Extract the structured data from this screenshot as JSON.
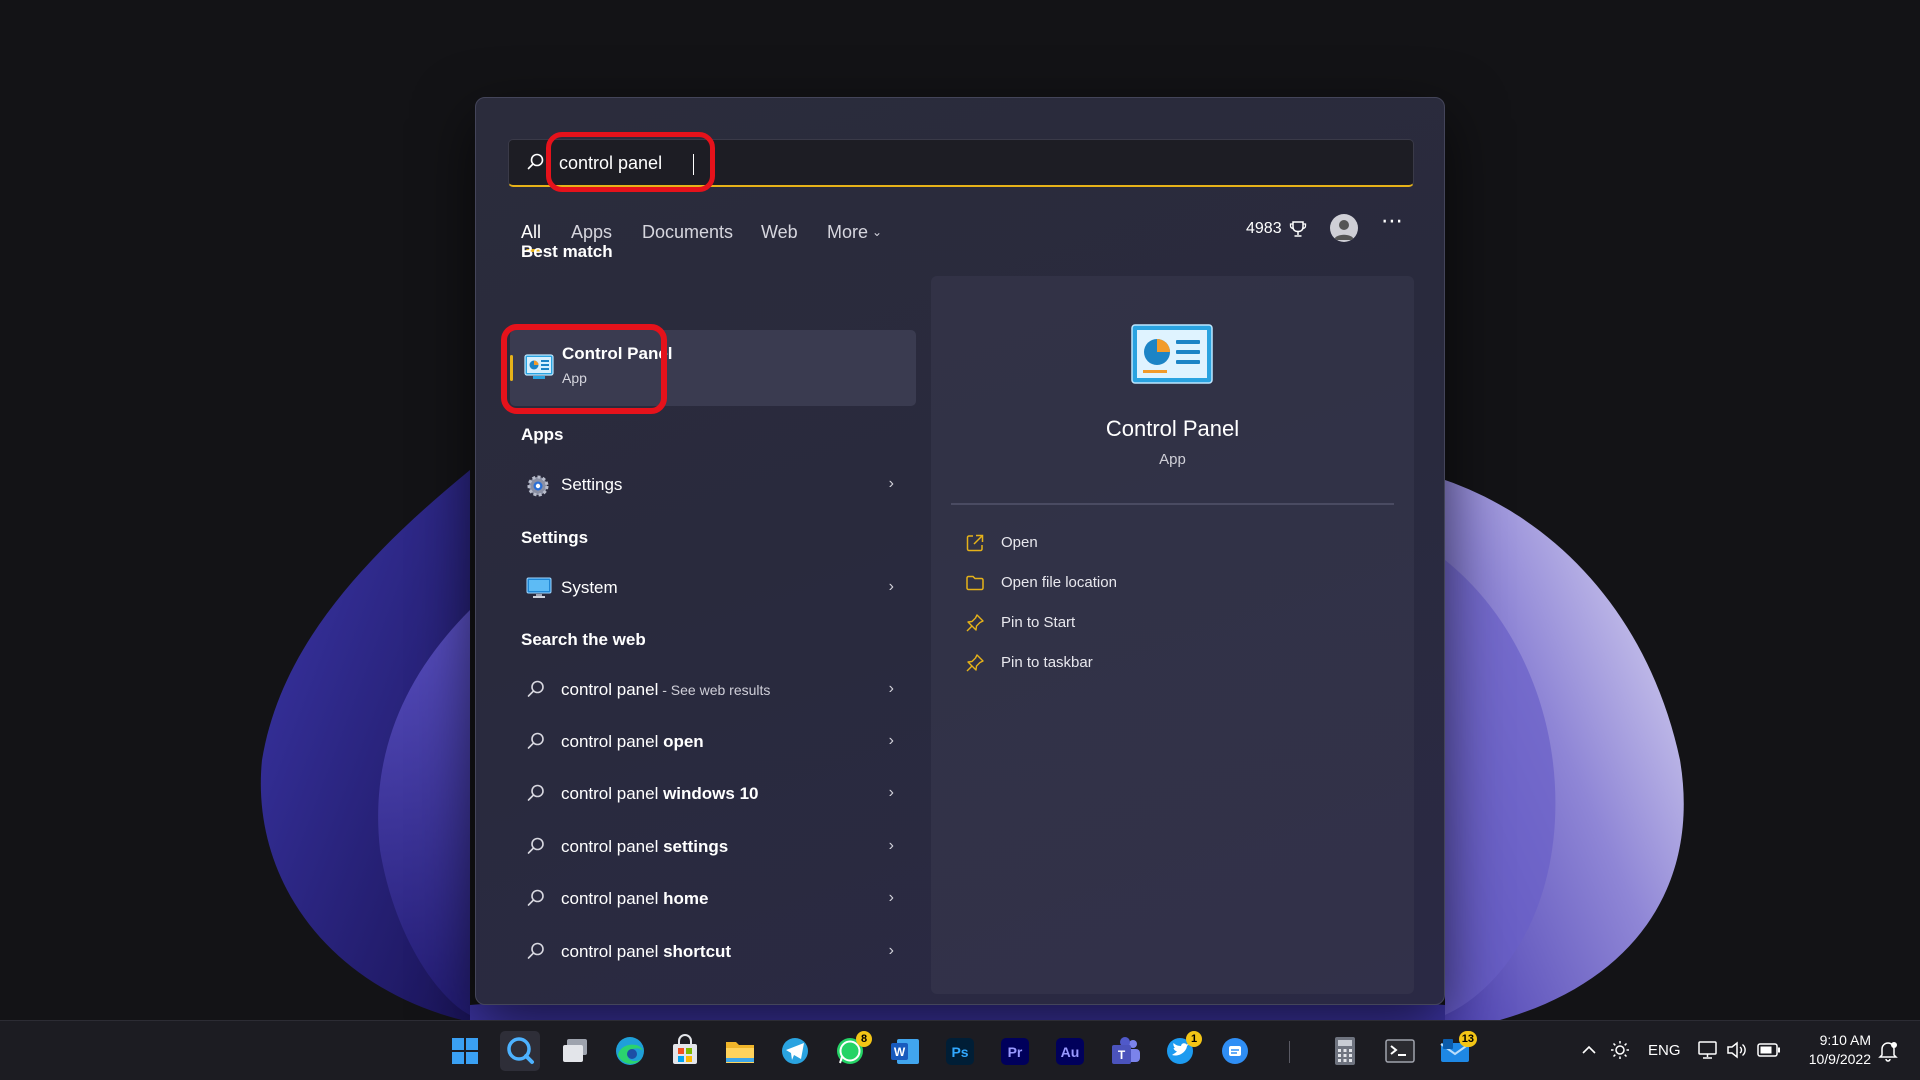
{
  "search": {
    "query": "control panel",
    "tabs": [
      "All",
      "Apps",
      "Documents",
      "Web",
      "More"
    ],
    "points": "4983"
  },
  "best_match": {
    "heading": "Best match",
    "title": "Control Panel",
    "subtitle": "App"
  },
  "apps": {
    "heading": "Apps",
    "items": [
      {
        "label": "Settings",
        "icon": "settings-gear-icon"
      }
    ]
  },
  "settings": {
    "heading": "Settings",
    "items": [
      {
        "label": "System",
        "icon": "monitor-icon"
      }
    ]
  },
  "web": {
    "heading": "Search the web",
    "items": [
      {
        "prefix": "control panel",
        "bold": "",
        "suffix": " - See web results"
      },
      {
        "prefix": "control panel ",
        "bold": "open",
        "suffix": ""
      },
      {
        "prefix": "control panel ",
        "bold": "windows 10",
        "suffix": ""
      },
      {
        "prefix": "control panel ",
        "bold": "settings",
        "suffix": ""
      },
      {
        "prefix": "control panel ",
        "bold": "home",
        "suffix": ""
      },
      {
        "prefix": "control panel ",
        "bold": "shortcut",
        "suffix": ""
      }
    ]
  },
  "detail": {
    "title": "Control Panel",
    "subtitle": "App",
    "actions": [
      "Open",
      "Open file location",
      "Pin to Start",
      "Pin to taskbar"
    ]
  },
  "taskbar": {
    "icons": [
      {
        "name": "windows-start-icon"
      },
      {
        "name": "search-icon",
        "active": true
      },
      {
        "name": "task-view-icon"
      },
      {
        "name": "edge-icon"
      },
      {
        "name": "microsoft-store-icon"
      },
      {
        "name": "file-explorer-icon"
      },
      {
        "name": "telegram-icon"
      },
      {
        "name": "whatsapp-icon",
        "badge": "8"
      },
      {
        "name": "word-icon"
      },
      {
        "name": "photoshop-icon",
        "text": "Ps"
      },
      {
        "name": "premiere-icon",
        "text": "Pr"
      },
      {
        "name": "audition-icon",
        "text": "Au"
      },
      {
        "name": "teams-icon"
      },
      {
        "name": "twitter-icon",
        "badge": "1"
      },
      {
        "name": "messenger-icon"
      },
      {
        "name": "calculator-icon"
      },
      {
        "name": "terminal-icon"
      },
      {
        "name": "mail-icon",
        "badge": "13"
      }
    ],
    "language": "ENG",
    "time": "9:10 AM",
    "date": "10/9/2022"
  },
  "colors": {
    "accent": "#e6b219",
    "highlight_ring": "#e5121b",
    "panel_bg": "#2a2b3e",
    "taskbar_bg": "#1c1c22"
  }
}
